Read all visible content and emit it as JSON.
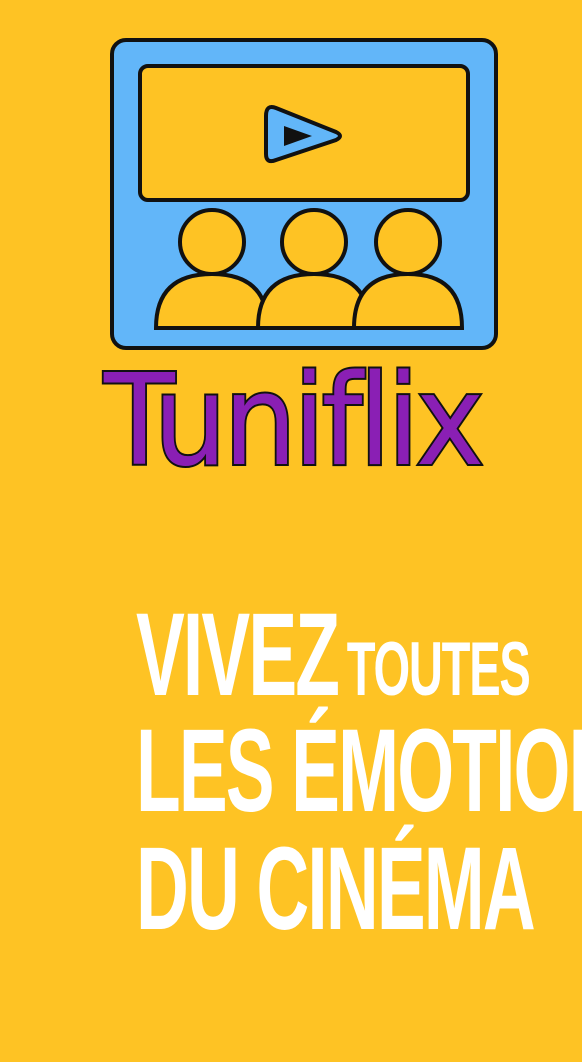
{
  "brand": {
    "name": "Tuniflix",
    "logo_icon": "cinema-screen-audience-icon",
    "name_color": "#8a1fb4"
  },
  "tagline": {
    "line1_big": "VIVEZ",
    "line1_small": "TOUTES",
    "line2": "LES ÉMOTIONS",
    "line3": "DU CINÉMA"
  },
  "colors": {
    "background": "#fec324",
    "icon_fill": "#62b6f9",
    "icon_outline": "#111111",
    "tagline_text": "#ffffff"
  }
}
